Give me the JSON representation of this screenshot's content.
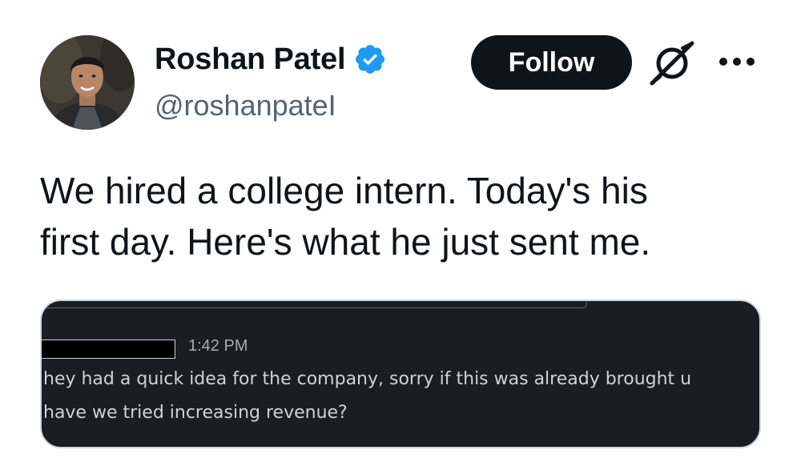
{
  "author": {
    "name": "Roshan Patel",
    "handle": "@roshanpateI",
    "verified": true,
    "avatar_icon": "profile-photo"
  },
  "actions": {
    "follow_label": "Follow",
    "grok_icon": "grok-icon",
    "more_icon": "more-options-icon"
  },
  "tweet": {
    "text_lines": [
      "We hired a college intern. Today's his",
      "first day. Here's what he just sent me."
    ]
  },
  "media": {
    "message_time": "1:42 PM",
    "message_lines": [
      "hey had a quick idea for the company, sorry if this was already brought u",
      "have we tried increasing revenue?"
    ]
  },
  "colors": {
    "text_primary": "#0f1419",
    "text_secondary": "#536471",
    "verified_blue": "#1d9bf0",
    "follow_bg": "#0f1419",
    "media_bg": "#1a1d21"
  }
}
